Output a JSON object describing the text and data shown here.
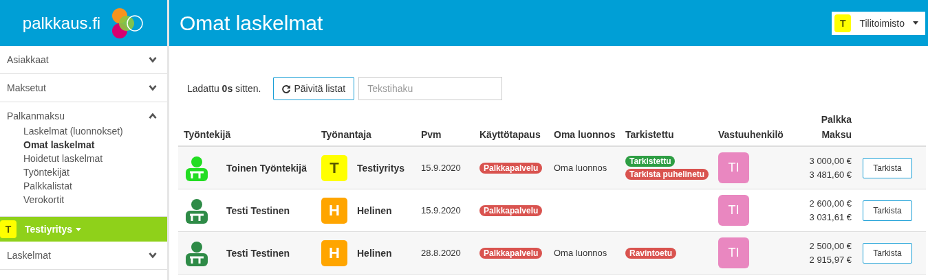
{
  "logo": {
    "text": "palkkaus.fi"
  },
  "sidebar": {
    "sections": [
      {
        "label": "Asiakkaat",
        "expanded": false
      },
      {
        "label": "Maksetut",
        "expanded": false
      },
      {
        "label": "Palkanmaksu",
        "expanded": true,
        "children": [
          {
            "label": "Laskelmat (luonnokset)",
            "selected": false
          },
          {
            "label": "Omat laskelmat",
            "selected": true
          },
          {
            "label": "Hoidetut laskelmat",
            "selected": false
          },
          {
            "label": "Työntekijät",
            "selected": false
          },
          {
            "label": "Palkkalistat",
            "selected": false
          },
          {
            "label": "Verokortit",
            "selected": false
          }
        ]
      }
    ],
    "company": {
      "badge": "T",
      "name": "Testiyritys"
    },
    "sections_after": [
      {
        "label": "Laskelmat",
        "expanded": false
      }
    ]
  },
  "header": {
    "title": "Omat laskelmat",
    "account": {
      "badge": "T",
      "name": "Tilitoimisto"
    }
  },
  "toolbar": {
    "loaded_prefix": "Ladattu ",
    "loaded_value": "0s",
    "loaded_suffix": " sitten.",
    "refresh_button": "Päivitä listat",
    "search": {
      "placeholder": "Tekstihaku"
    }
  },
  "table": {
    "columns": [
      "Työntekijä",
      "Työnantaja",
      "Pvm",
      "Käyttötapaus",
      "Oma luonnos",
      "Tarkistettu",
      "Vastuuhenkilö",
      [
        "Palkka",
        "Maksu"
      ]
    ],
    "rows": [
      {
        "employee": {
          "color": "#22dd22",
          "name": "Toinen Työntekijä"
        },
        "employer": {
          "badge": "T",
          "color": "#ffff00",
          "name": "Testiyritys"
        },
        "date": "15.9.2020",
        "use_case": [
          {
            "label": "Palkkapalvelu",
            "color": "#d9534f"
          }
        ],
        "own_draft": "Oma luonnos",
        "checked": [
          {
            "label": "Tarkistettu",
            "color": "#2e9e44"
          },
          {
            "label": "Tarkista puhelinetu",
            "color": "#d9534f"
          }
        ],
        "responsible": "TI",
        "salary": "3 000,00 €",
        "payment": "3 481,60 €",
        "action": "Tarkista"
      },
      {
        "employee": {
          "color": "#2e8b47",
          "name": "Testi Testinen"
        },
        "employer": {
          "badge": "H",
          "color": "#ffa500",
          "name": "Helinen"
        },
        "date": "15.9.2020",
        "use_case": [
          {
            "label": "Palkkapalvelu",
            "color": "#d9534f"
          }
        ],
        "checked": [],
        "responsible": "TI",
        "salary": "2 600,00 €",
        "payment": "3 031,61 €",
        "action": "Tarkista"
      },
      {
        "employee": {
          "color": "#2e8b47",
          "name": "Testi Testinen"
        },
        "employer": {
          "badge": "H",
          "color": "#ffa500",
          "name": "Helinen"
        },
        "date": "28.8.2020",
        "use_case": [
          {
            "label": "Palkkapalvelu",
            "color": "#d9534f"
          }
        ],
        "own_draft": "Oma luonnos",
        "checked": [
          {
            "label": "Ravintoetu",
            "color": "#d9534f"
          }
        ],
        "responsible": "TI",
        "salary": "2 500,00 €",
        "payment": "2 915,97 €",
        "action": "Tarkista"
      }
    ]
  }
}
